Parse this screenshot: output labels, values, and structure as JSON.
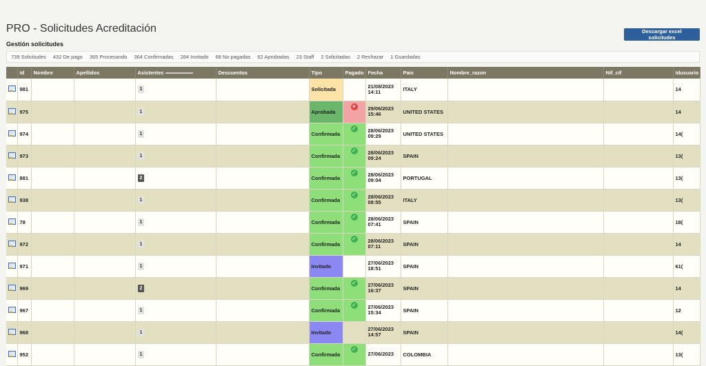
{
  "page": {
    "title": "PRO - Solicitudes Acreditación",
    "subtitle": "Gestión solicitudes",
    "download_label": "Descargar excel solicitudes"
  },
  "stats": [
    "739 Solicitudes",
    "432 De pago",
    "365 Procesando",
    "364 Confirmadas",
    "284 Invitado",
    "68 No pagadas",
    "62 Aprobadas",
    "23 Staff",
    "2 Solicitadas",
    "2 Rechazar",
    "1 Guardadas"
  ],
  "columns": [
    "",
    "Id",
    "Nombre",
    "Apellidos",
    "Asistentes",
    "Descuentos",
    "Tipo",
    "Pagado",
    "Fecha",
    "Pais",
    "Nombre_razon",
    "Nif_cif",
    "Idusuario"
  ],
  "icons": {
    "row": "edit-doc-icon",
    "paid": "check-icon",
    "unpaid": "cross-icon"
  },
  "colors": {
    "solicitada": "#fde3a8",
    "aprobada": "#6ab66b",
    "confirmada": "#8ede7a",
    "invitado": "#8b87f3",
    "not_paid": "#f2a3a3",
    "header": "#7b7762",
    "button": "#2d5f9a"
  },
  "rows": [
    {
      "id": "981",
      "asistentes": "1",
      "tipo": "Solicitada",
      "pagado": "",
      "fecha": "21/08/2023",
      "hora": "14:11",
      "pais": "ITALY",
      "idusuario": "14"
    },
    {
      "id": "975",
      "asistentes": "1",
      "tipo": "Aprobada",
      "pagado": "no",
      "fecha": "29/06/2023",
      "hora": "15:46",
      "pais": "UNITED STATES",
      "idusuario": "14"
    },
    {
      "id": "974",
      "asistentes": "1",
      "tipo": "Confirmada",
      "pagado": "yes",
      "fecha": "28/06/2023",
      "hora": "09:29",
      "pais": "UNITED STATES",
      "idusuario": "14("
    },
    {
      "id": "973",
      "asistentes": "1",
      "tipo": "Confirmada",
      "pagado": "yes",
      "fecha": "28/06/2023",
      "hora": "09:24",
      "pais": "SPAIN",
      "idusuario": "13("
    },
    {
      "id": "881",
      "asistentes": "2",
      "tipo": "Confirmada",
      "pagado": "yes",
      "fecha": "28/06/2023",
      "hora": "09:04",
      "pais": "PORTUGAL",
      "idusuario": "13("
    },
    {
      "id": "938",
      "asistentes": "1",
      "tipo": "Confirmada",
      "pagado": "yes",
      "fecha": "28/06/2023",
      "hora": "08:55",
      "pais": "ITALY",
      "idusuario": "13("
    },
    {
      "id": "78",
      "asistentes": "1",
      "tipo": "Confirmada",
      "pagado": "yes",
      "fecha": "28/06/2023",
      "hora": "07:41",
      "pais": "SPAIN",
      "idusuario": "18("
    },
    {
      "id": "972",
      "asistentes": "1",
      "tipo": "Confirmada",
      "pagado": "yes",
      "fecha": "28/06/2023",
      "hora": "07:11",
      "pais": "SPAIN",
      "idusuario": "14"
    },
    {
      "id": "971",
      "asistentes": "1",
      "tipo": "Invitado",
      "pagado": "",
      "fecha": "27/06/2023",
      "hora": "18:51",
      "pais": "SPAIN",
      "idusuario": "61("
    },
    {
      "id": "969",
      "asistentes": "2",
      "tipo": "Confirmada",
      "pagado": "yes",
      "fecha": "27/06/2023",
      "hora": "16:37",
      "pais": "SPAIN",
      "idusuario": "14"
    },
    {
      "id": "967",
      "asistentes": "1",
      "tipo": "Confirmada",
      "pagado": "yes",
      "fecha": "27/06/2023",
      "hora": "15:34",
      "pais": "SPAIN",
      "idusuario": "12"
    },
    {
      "id": "968",
      "asistentes": "1",
      "tipo": "Invitado",
      "pagado": "",
      "fecha": "27/06/2023",
      "hora": "14:57",
      "pais": "SPAIN",
      "idusuario": "14("
    },
    {
      "id": "952",
      "asistentes": "1",
      "tipo": "Confirmada",
      "pagado": "yes",
      "fecha": "27/06/2023",
      "hora": "",
      "pais": "COLOMBIA",
      "idusuario": "13("
    }
  ]
}
